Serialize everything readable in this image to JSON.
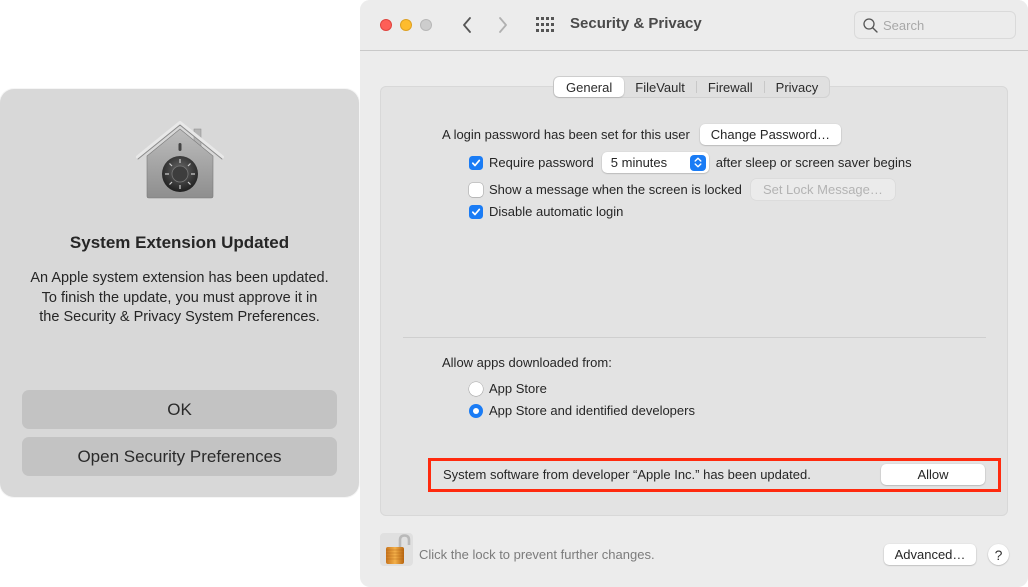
{
  "alert": {
    "icon": "filevault-house-icon",
    "title": "System Extension Updated",
    "message": "An Apple system extension has been updated. To finish the update, you must approve it in the Security & Privacy System Preferences.",
    "buttons": {
      "ok": "OK",
      "open_prefs": "Open Security Preferences"
    }
  },
  "window": {
    "title": "Security & Privacy",
    "traffic_lights": [
      "close",
      "minimize",
      "zoom"
    ],
    "nav": {
      "back_icon": "chevron-left-icon",
      "forward_icon": "chevron-right-icon",
      "grid_icon": "show-all-grid-icon"
    },
    "search": {
      "placeholder": "Search",
      "value": ""
    },
    "tabs": [
      {
        "label": "General",
        "active": true
      },
      {
        "label": "FileVault",
        "active": false
      },
      {
        "label": "Firewall",
        "active": false
      },
      {
        "label": "Privacy",
        "active": false
      }
    ],
    "general": {
      "login_password_text": "A login password has been set for this user",
      "change_password_button": "Change Password…",
      "require_password": {
        "label": "Require password",
        "checked": true,
        "popup_value": "5 minutes",
        "suffix": "after sleep or screen saver begins"
      },
      "show_message": {
        "label": "Show a message when the screen is locked",
        "checked": false,
        "button": "Set Lock Message…"
      },
      "disable_autologin": {
        "label": "Disable automatic login",
        "checked": true
      },
      "allow_apps_label": "Allow apps downloaded from:",
      "allow_apps_options": [
        {
          "label": "App Store",
          "selected": false
        },
        {
          "label": "App Store and identified developers",
          "selected": true
        }
      ],
      "system_software_notice": "System software from developer “Apple Inc.” has been updated.",
      "allow_button": "Allow"
    },
    "footer": {
      "lock_text": "Click the lock to prevent further changes.",
      "lock_state": "unlocked",
      "advanced_button": "Advanced…",
      "help_button": "?"
    }
  },
  "colors": {
    "accent": "#1a7cf5",
    "highlight_border": "#ff2a0e",
    "close": "#fe5f57",
    "minimize": "#febc2e",
    "zoom_inactive": "#cdcdcd"
  }
}
